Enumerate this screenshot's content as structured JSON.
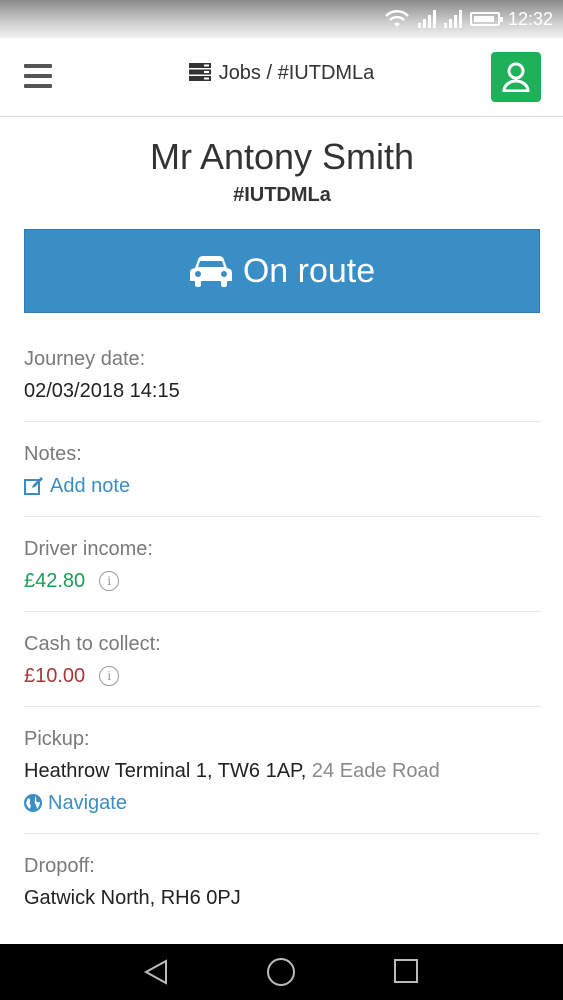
{
  "statusbar": {
    "time": "12:32"
  },
  "header": {
    "breadcrumb": "Jobs / #IUTDMLa"
  },
  "job": {
    "customer_name": "Mr Antony Smith",
    "reference": "#IUTDMLa",
    "status_label": "On route"
  },
  "details": {
    "journey_date": {
      "label": "Journey date:",
      "value": "02/03/2018 14:15"
    },
    "notes": {
      "label": "Notes:",
      "action": "Add note"
    },
    "driver_income": {
      "label": "Driver income:",
      "value": "£42.80"
    },
    "cash_to_collect": {
      "label": "Cash to collect:",
      "value": "£10.00"
    },
    "pickup": {
      "label": "Pickup:",
      "address": "Heathrow Terminal 1, TW6 1AP,",
      "address_extra": "24 Eade Road",
      "action": "Navigate"
    },
    "dropoff": {
      "label": "Dropoff:",
      "address": "Gatwick North, RH6 0PJ"
    }
  },
  "colors": {
    "primary": "#3a8ec6",
    "success": "#1fb15a",
    "income": "#1f9b5a",
    "cash": "#a33a3a"
  },
  "icons": {
    "menu": "hamburger-icon",
    "breadcrumb": "server-icon",
    "profile": "user-icon",
    "status": "car-icon",
    "notes": "edit-icon",
    "info": "info-icon",
    "navigate": "globe-icon"
  }
}
